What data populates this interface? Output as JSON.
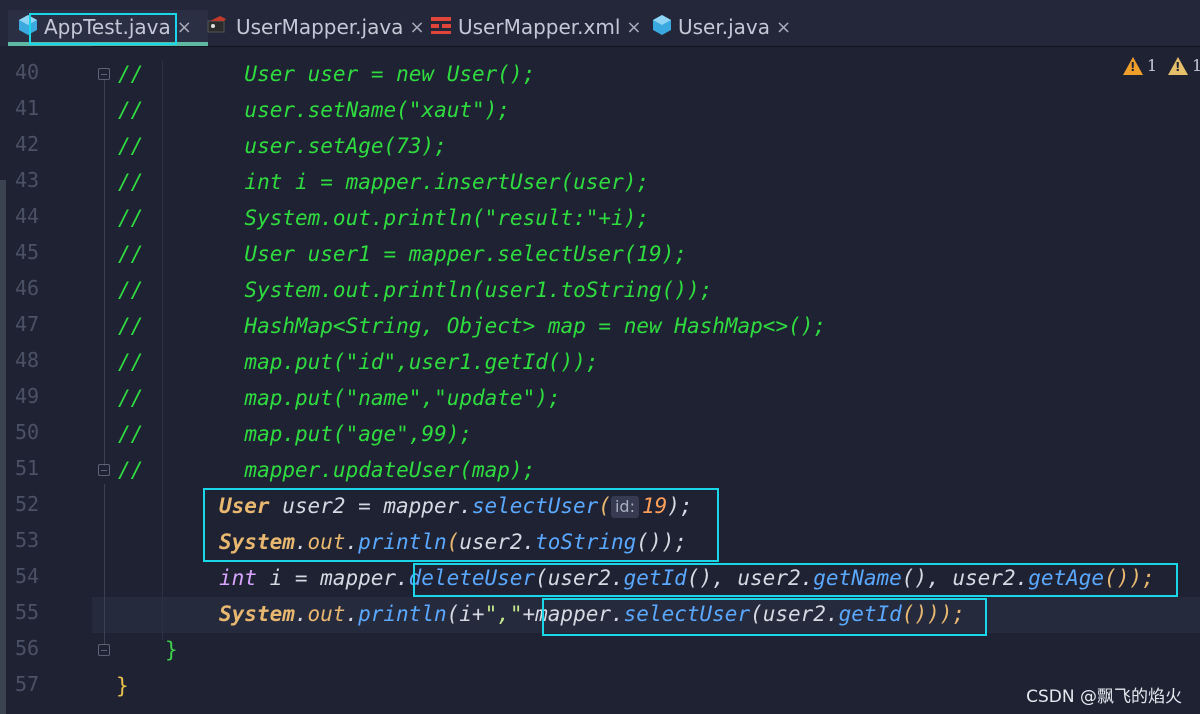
{
  "tabs": [
    {
      "label": "AppTest.java",
      "icon": "java-class-icon",
      "active": true
    },
    {
      "label": "UserMapper.java",
      "icon": "mybatis-interface-icon",
      "active": false
    },
    {
      "label": "UserMapper.xml",
      "icon": "xml-file-icon",
      "active": false
    },
    {
      "label": "User.java",
      "icon": "java-class-icon",
      "active": false
    }
  ],
  "close_glyph": "×",
  "inspections": {
    "warnings": "1",
    "weak_warnings": "1"
  },
  "lines": [
    {
      "no": "40",
      "text": "//        User user = new User();"
    },
    {
      "no": "41",
      "text": "//        user.setName(\"xaut\");"
    },
    {
      "no": "42",
      "text": "//        user.setAge(73);"
    },
    {
      "no": "43",
      "text": "//        int i = mapper.insertUser(user);"
    },
    {
      "no": "44",
      "text": "//        System.out.println(\"result:\"+i);"
    },
    {
      "no": "45",
      "text": "//        User user1 = mapper.selectUser(19);"
    },
    {
      "no": "46",
      "text": "//        System.out.println(user1.toString());"
    },
    {
      "no": "47",
      "text": "//        HashMap<String, Object> map = new HashMap<>();"
    },
    {
      "no": "48",
      "text": "//        map.put(\"id\",user1.getId());"
    },
    {
      "no": "49",
      "text": "//        map.put(\"name\",\"update\");"
    },
    {
      "no": "50",
      "text": "//        map.put(\"age\",99);"
    },
    {
      "no": "51",
      "text": "//        mapper.updateUser(map);"
    },
    {
      "no": "52"
    },
    {
      "no": "53"
    },
    {
      "no": "54"
    },
    {
      "no": "55"
    },
    {
      "no": "56",
      "text": "}"
    },
    {
      "no": "57",
      "text": "}"
    }
  ],
  "code52": {
    "type": "User",
    "rest": " user2 = mapper.",
    "meth": "selectUser",
    "open": "(",
    "hint": "id:",
    "num": "19",
    "close": ");"
  },
  "code53": {
    "cls": "System",
    "dot1": ".",
    "fld": "out",
    "dot2": ".",
    "meth": "println",
    "open": "(",
    "var": "user2.",
    "m2": "toString",
    "close": "());"
  },
  "code54": {
    "kw": "int",
    "a": " i = mapper.",
    "m1": "deleteUser",
    "b": "(user2.",
    "m2": "getId",
    "c": "(), user2.",
    "m3": "getName",
    "d": "(), user2.",
    "m4": "getAge",
    "e": "());"
  },
  "code55": {
    "cls": "System",
    "dot1": ".",
    "fld": "out",
    "dot2": ".",
    "meth": "println",
    "a": "(i+",
    "str": "\",\"",
    "b": "+mapper.",
    "m1": "selectUser",
    "c": "(user2.",
    "m2": "getId",
    "d": "()));"
  },
  "watermark": "CSDN @飘飞的焰火"
}
